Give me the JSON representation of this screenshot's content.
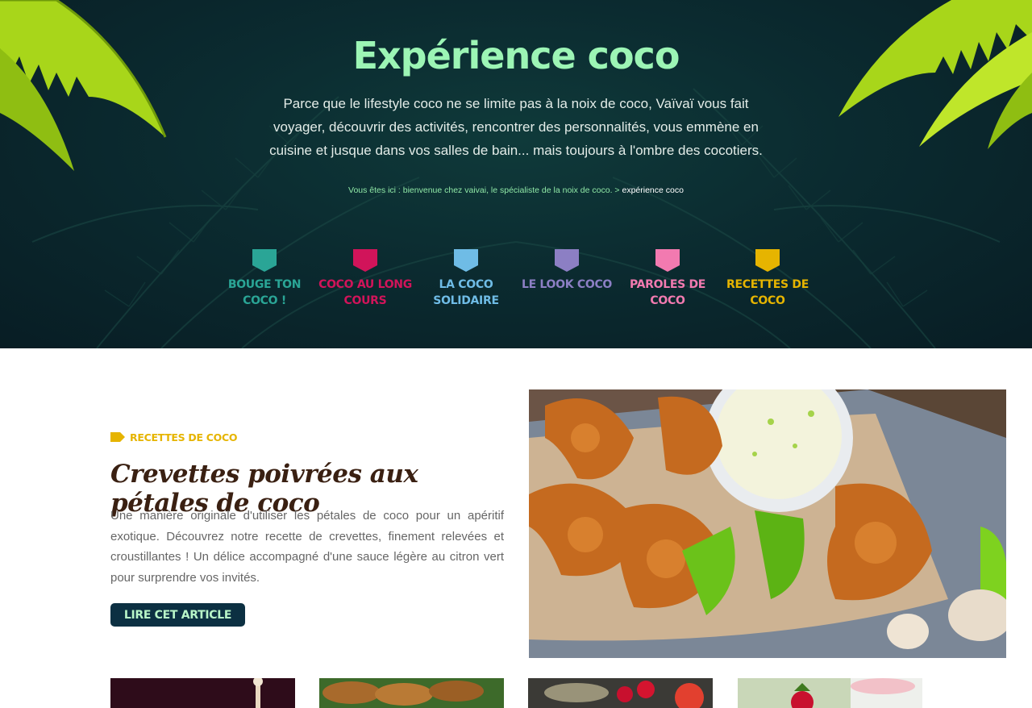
{
  "hero": {
    "title": "Expérience coco",
    "intro": "Parce que le lifestyle coco ne se limite pas à la noix de coco, Vaïvaï vous fait voyager, découvrir des activités, rencontrer des personnalités, vous emmène en cuisine et jusque dans vos salles de bain... mais toujours à l'ombre des cocotiers.",
    "breadcrumb": {
      "prefix": "Vous êtes ici :",
      "home": "bienvenue chez vaivai, le spécialiste de la noix de coco.",
      "separator": ">",
      "current": "expérience coco"
    }
  },
  "categories": [
    {
      "label": "BOUGE TON COCO !",
      "color": "#2aa596"
    },
    {
      "label": "COCO AU LONG COURS",
      "color": "#d1145a"
    },
    {
      "label": "LA COCO SOLIDAIRE",
      "color": "#6fbce6"
    },
    {
      "label": "LE LOOK COCO",
      "color": "#8c7fc4"
    },
    {
      "label": "PAROLES DE COCO",
      "color": "#f27ab0"
    },
    {
      "label": "RECETTES DE COCO",
      "color": "#e6b400"
    }
  ],
  "featured": {
    "category": "RECETTES DE COCO",
    "category_color": "#e6b400",
    "title": "Crevettes poivrées aux pétales de coco",
    "excerpt": "Une manière originale d'utiliser les pétales de coco pour un apéritif exotique. Découvrez notre recette de crevettes, finement relevées et croustillantes ! Un délice accompagné d'une sauce légère au citron vert pour surprendre vos invités.",
    "button_label": "LIRE CET ARTICLE",
    "image_icon": "shrimp-photo"
  },
  "thumbnails": [
    {
      "icon": "dark-drink-photo"
    },
    {
      "icon": "grilled-skewers-photo"
    },
    {
      "icon": "strawberry-table-photo"
    },
    {
      "icon": "strawberry-dessert-photo"
    }
  ]
}
